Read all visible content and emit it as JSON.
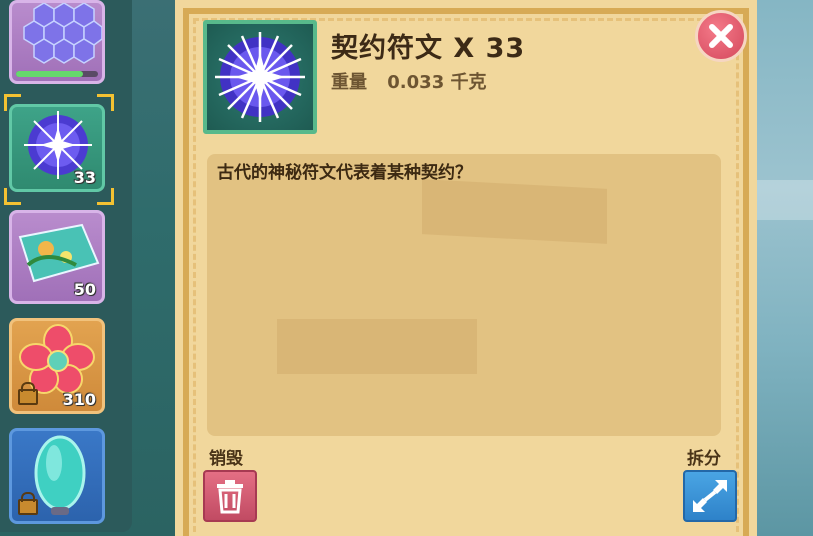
{
  "inventory": {
    "slots": [
      {
        "count": "",
        "frame": "purple",
        "icon": "hex-crystal-icon",
        "progress": 0.82
      },
      {
        "count": "33",
        "frame": "green",
        "icon": "rune-star-icon",
        "selected": true
      },
      {
        "count": "50",
        "frame": "purple",
        "icon": "nature-card-icon"
      },
      {
        "count": "310",
        "frame": "orange",
        "icon": "flower-icon",
        "locked": true
      },
      {
        "count": "",
        "frame": "blue",
        "icon": "mirror-icon",
        "locked": true
      }
    ]
  },
  "item": {
    "name_with_count": "契约符文 X 33",
    "weight_label": "重量",
    "weight_value": "0.033 千克",
    "description": "古代的神秘符文代表着某种契约？",
    "icon": "rune-star-icon"
  },
  "actions": {
    "destroy_label": "销毁",
    "split_label": "拆分",
    "destroy_icon": "trash-icon",
    "split_icon": "expand-arrows-icon",
    "close_icon": "close-icon"
  },
  "colors": {
    "panel_bg": "#f1d79c",
    "panel_border": "#d7aa55",
    "destroy": "#d85a72",
    "split": "#3a94d8",
    "close": "#d4485c",
    "selection": "#f4c232"
  }
}
